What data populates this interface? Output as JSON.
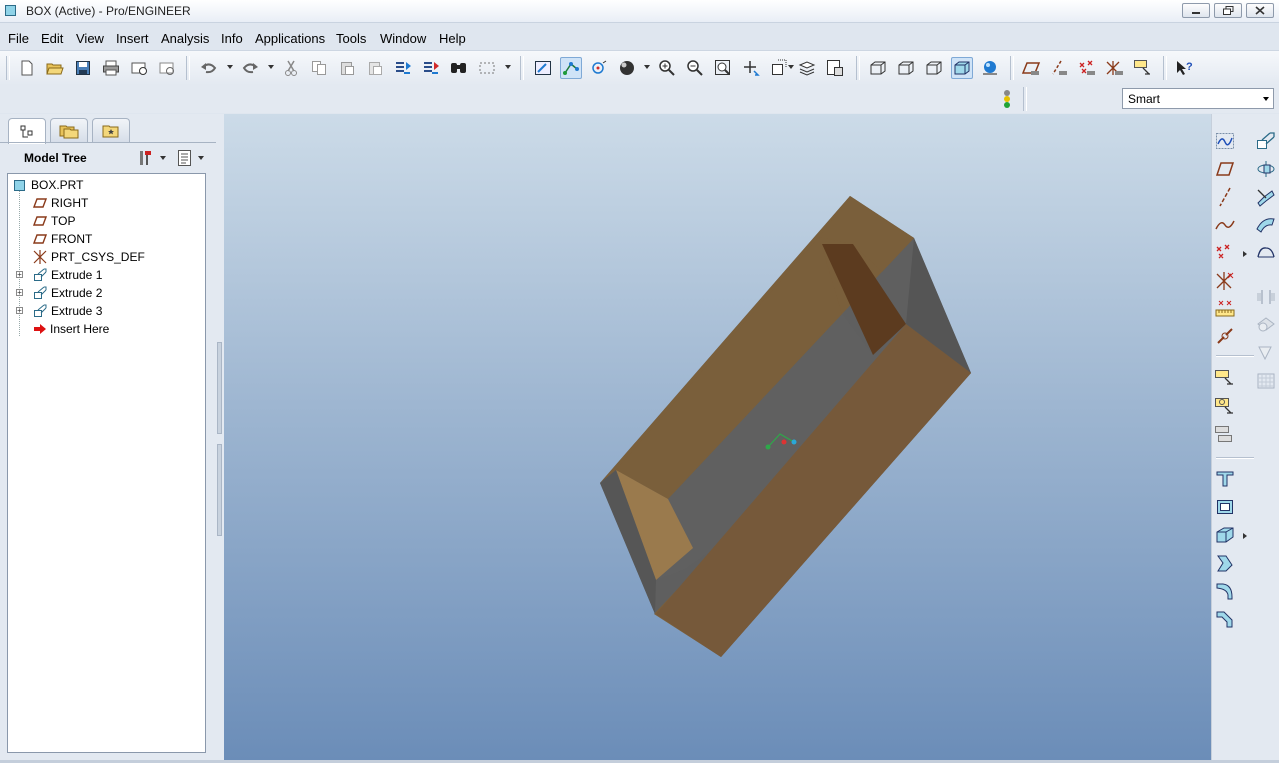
{
  "window": {
    "title": "BOX (Active) - Pro/ENGINEER",
    "controls": [
      "minimize",
      "maximize",
      "close"
    ]
  },
  "menu": [
    "File",
    "Edit",
    "View",
    "Insert",
    "Analysis",
    "Info",
    "Applications",
    "Tools",
    "Window",
    "Help"
  ],
  "toolbar": {
    "filter_label": "Smart",
    "icons": [
      "new-icon",
      "open-icon",
      "save-icon",
      "print-icon",
      "email-icon",
      "email-link-icon",
      "undo-icon",
      "redo-icon",
      "cut-icon",
      "copy-icon",
      "paste-icon",
      "paste-special-icon",
      "regenerate-icon",
      "regenerate-manager-icon",
      "find-icon",
      "select-box-icon",
      "repaint-icon",
      "spin-center-icon",
      "orient-mode-icon",
      "appearance-sphere-icon",
      "zoom-in-icon",
      "zoom-out-icon",
      "refit-icon",
      "reorient-icon",
      "saved-views-icon",
      "layers-icon",
      "view-manager-icon",
      "wireframe-icon",
      "hidden-line-icon",
      "no-hidden-icon",
      "shading-icon",
      "enhanced-realism-icon",
      "datum-planes-icon",
      "datum-axes-icon",
      "datum-points-icon",
      "coordinate-systems-icon",
      "annotations-icon",
      "context-help-icon",
      "status-light-icon"
    ]
  },
  "left_panel": {
    "tabs": [
      "model-tree-tab",
      "folder-browser-tab",
      "favorites-tab"
    ],
    "title": "Model Tree",
    "tree": [
      {
        "label": "BOX.PRT",
        "type": "part"
      },
      {
        "label": "RIGHT",
        "type": "datum-plane"
      },
      {
        "label": "TOP",
        "type": "datum-plane"
      },
      {
        "label": "FRONT",
        "type": "datum-plane"
      },
      {
        "label": "PRT_CSYS_DEF",
        "type": "csys"
      },
      {
        "label": "Extrude 1",
        "type": "extrude",
        "expandable": true
      },
      {
        "label": "Extrude 2",
        "type": "extrude",
        "expandable": true
      },
      {
        "label": "Extrude 3",
        "type": "extrude",
        "expandable": true
      },
      {
        "label": "Insert Here",
        "type": "insert"
      }
    ]
  },
  "right_toolbar": {
    "icons": [
      "sketched-curve-icon",
      "datum-plane-tool-icon",
      "datum-axis-tool-icon",
      "datum-curve-tool-icon",
      "datum-point-tool-icon",
      "csys-tool-icon",
      "analysis-feature-icon",
      "publish-geometry-icon",
      "extrude-tool-icon",
      "revolve-tool-icon",
      "variable-sweep-icon",
      "blend-boundary-icon",
      "style-tool-icon",
      "mirror-icon",
      "merge-icon",
      "trim-icon",
      "pattern-icon",
      "hole-tool-icon",
      "shell-tool-icon",
      "rib-tool-icon",
      "draft-tool-icon",
      "round-tool-icon",
      "chamfer-tool-icon"
    ]
  },
  "colors": {
    "model_face_top": "#7a5f3b",
    "model_face_gray": "#606060",
    "model_inner_dark": "#5c3b1f",
    "model_end_light": "#9a7a4d",
    "viewport_top": "#ccdbe8",
    "viewport_bottom": "#6b8db8"
  }
}
